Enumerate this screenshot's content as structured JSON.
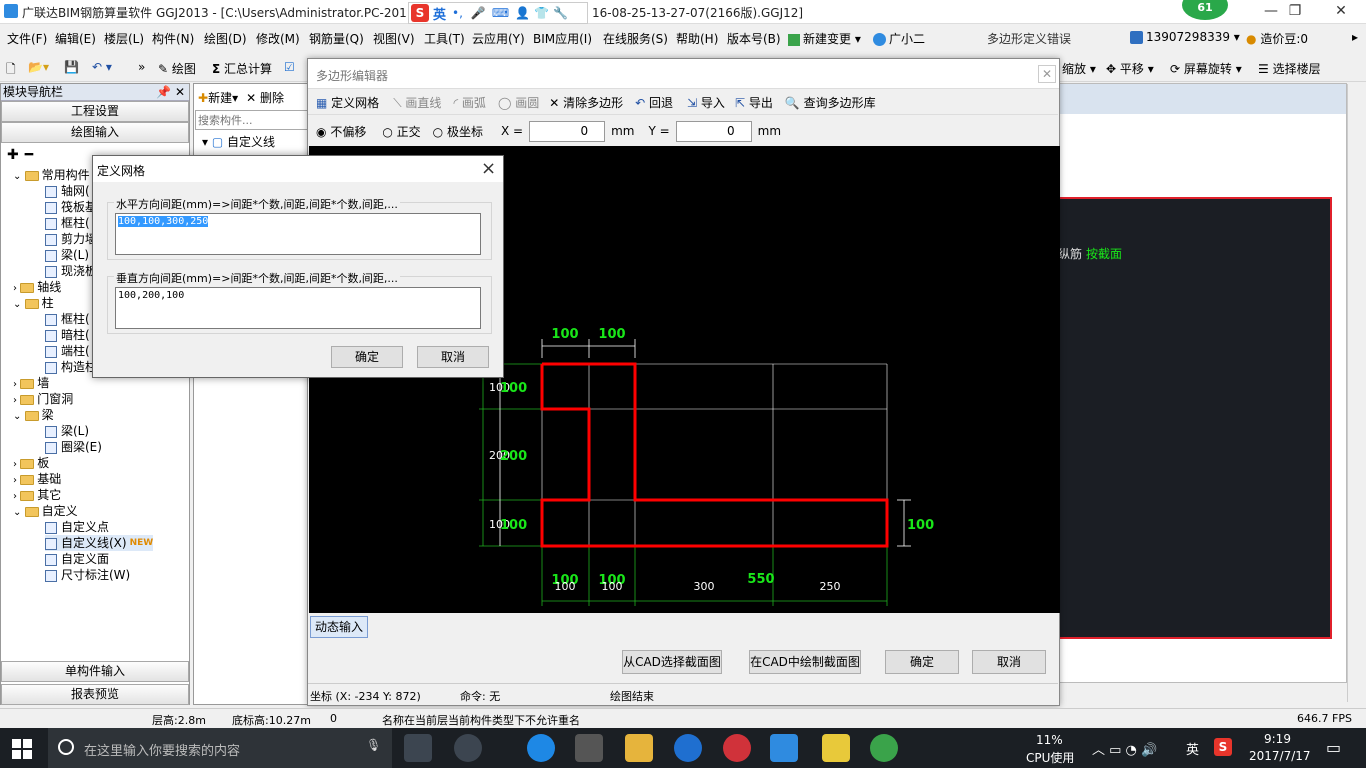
{
  "window": {
    "title": "广联达BIM钢筋算量软件 GGJ2013 - [C:\\Users\\Administrator.PC-201",
    "title_suffix": "16-08-25-13-27-07(2166版).GGJ12]",
    "ime_label": "英"
  },
  "menubar": {
    "items": [
      "文件(F)",
      "编辑(E)",
      "楼层(L)",
      "构件(N)",
      "绘图(D)",
      "修改(M)",
      "钢筋量(Q)",
      "视图(V)",
      "工具(T)",
      "云应用(Y)",
      "BIM应用(I)",
      "在线服务(S)",
      "帮助(H)",
      "版本号(B)",
      "新建变更",
      "广小二"
    ],
    "notice": "多边形定义错误",
    "phone": "13907298339",
    "price": "造价豆:0",
    "badge": "61"
  },
  "toolbar": {
    "draw": "绘图",
    "sum": "汇总计算",
    "zoom": "缩放",
    "pan": "平移",
    "rotate": "屏幕旋转",
    "select_floor": "选择楼层"
  },
  "nav": {
    "title": "模块导航栏",
    "pin": "ᵖ",
    "project_settings": "工程设置",
    "draw_input": "绘图输入",
    "single_input": "单构件输入",
    "report_preview": "报表预览",
    "tree": [
      {
        "label": "常用构件",
        "level": 0,
        "kind": "folder"
      },
      {
        "label": "轴网(",
        "level": 1,
        "kind": "leaf"
      },
      {
        "label": "筏板基",
        "level": 1,
        "kind": "leaf"
      },
      {
        "label": "框柱(",
        "level": 1,
        "kind": "leaf"
      },
      {
        "label": "剪力墙",
        "level": 1,
        "kind": "leaf"
      },
      {
        "label": "梁(L)",
        "level": 1,
        "kind": "leaf"
      },
      {
        "label": "现浇板",
        "level": 1,
        "kind": "leaf"
      },
      {
        "label": "轴线",
        "level": 0,
        "kind": "folder"
      },
      {
        "label": "柱",
        "level": 0,
        "kind": "folder"
      },
      {
        "label": "框柱(",
        "level": 1,
        "kind": "leaf"
      },
      {
        "label": "暗柱(",
        "level": 1,
        "kind": "leaf"
      },
      {
        "label": "端柱(",
        "level": 1,
        "kind": "leaf"
      },
      {
        "label": "构造柱",
        "level": 1,
        "kind": "leaf"
      },
      {
        "label": "墙",
        "level": 0,
        "kind": "folder"
      },
      {
        "label": "门窗洞",
        "level": 0,
        "kind": "folder"
      },
      {
        "label": "梁",
        "level": 0,
        "kind": "folder"
      },
      {
        "label": "梁(L)",
        "level": 1,
        "kind": "leaf"
      },
      {
        "label": "圈梁(E)",
        "level": 1,
        "kind": "leaf"
      },
      {
        "label": "板",
        "level": 0,
        "kind": "folder"
      },
      {
        "label": "基础",
        "level": 0,
        "kind": "folder"
      },
      {
        "label": "其它",
        "level": 0,
        "kind": "folder"
      },
      {
        "label": "自定义",
        "level": 0,
        "kind": "folder"
      },
      {
        "label": "自定义点",
        "level": 1,
        "kind": "leaf"
      },
      {
        "label": "自定义线(X)",
        "level": 1,
        "kind": "leaf"
      },
      {
        "label": "自定义面",
        "level": 1,
        "kind": "leaf"
      },
      {
        "label": "尺寸标注(W)",
        "level": 1,
        "kind": "leaf"
      }
    ],
    "new_tag": "NEW"
  },
  "complist": {
    "new": "新建",
    "delete": "删除",
    "search_placeholder": "搜索构件...",
    "item": "自定义线"
  },
  "workarea": {
    "text1": "纵筋",
    "text2": "按截面"
  },
  "poly_editor": {
    "title": "多边形编辑器",
    "tools": {
      "define_grid": "定义网格",
      "draw_line": "画直线",
      "draw_arc": "画弧",
      "draw_circle": "画圆",
      "clear": "清除多边形",
      "undo": "回退",
      "import": "导入",
      "export": "导出",
      "library": "查询多边形库"
    },
    "options": {
      "no_offset": "不偏移",
      "orthogonal": "正交",
      "polar": "极坐标",
      "x_label": "X =",
      "x_value": "0",
      "y_label": "Y =",
      "y_value": "0",
      "unit": "mm"
    },
    "dynamic_input": "动态输入",
    "btn_cad_select": "从CAD选择截面图",
    "btn_cad_draw": "在CAD中绘制截面图",
    "btn_ok": "确定",
    "btn_cancel": "取消",
    "status_coord": "坐标 (X: -234 Y: 872)",
    "status_cmd": "命令: 无",
    "status_end": "绘图结束",
    "dims": {
      "top": [
        "100",
        "100"
      ],
      "left_white": [
        "100",
        "200",
        "100"
      ],
      "left_green": [
        "100",
        "200",
        "100"
      ],
      "right": "100",
      "bottom_white": [
        "100",
        "100",
        "300",
        "250"
      ],
      "bottom_green": [
        "100",
        "100",
        "550"
      ]
    }
  },
  "grid_dialog": {
    "title": "定义网格",
    "close": "×",
    "h_label": "水平方向间距(mm)=>间距*个数,间距,间距*个数,间距,...",
    "h_value": "100,100,300,250",
    "v_label": "垂直方向间距(mm)=>间距*个数,间距,间距*个数,间距,...",
    "v_value": "100,200,100",
    "ok": "确定",
    "cancel": "取消"
  },
  "statusbar": {
    "floor_height": "层高:2.8m",
    "base_height": "底标高:10.27m",
    "zero": "0",
    "message": "名称在当前层当前构件类型下不允许重名",
    "fps": "646.7 FPS"
  },
  "taskbar": {
    "search_placeholder": "在这里输入你要搜索的内容",
    "cpu_percent": "11%",
    "cpu_label": "CPU使用",
    "ime": "英",
    "time": "9:19",
    "date": "2017/7/17"
  },
  "colors": {
    "polygon": "#ff0000",
    "dim_green": "#00ff00",
    "grid": "#ffffff",
    "selection": "#3399ff"
  }
}
